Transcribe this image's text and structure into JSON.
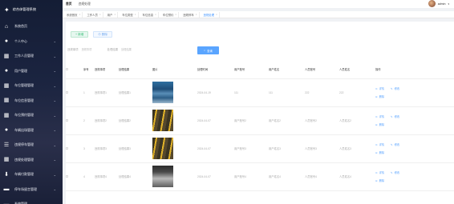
{
  "sidebar": {
    "logo_text": "综合体管理系统",
    "items": [
      {
        "label": "系统首页",
        "icon": "home-icon",
        "glyph": "⌂",
        "has_chevron": false
      },
      {
        "label": "个人中心",
        "icon": "user-icon",
        "glyph": "●",
        "has_chevron": true
      },
      {
        "label": "工作人员管理",
        "icon": "grid-icon",
        "glyph": "▦",
        "has_chevron": true
      },
      {
        "label": "用户管理",
        "icon": "user-group-icon",
        "glyph": "●",
        "has_chevron": true
      },
      {
        "label": "车位管理管理",
        "icon": "grid-icon",
        "glyph": "▦",
        "has_chevron": true
      },
      {
        "label": "车位信息管理",
        "icon": "grid-icon",
        "glyph": "▦",
        "has_chevron": true
      },
      {
        "label": "车位预约管理",
        "icon": "grid-icon",
        "glyph": "▦",
        "has_chevron": true
      },
      {
        "label": "车辆出场管理",
        "icon": "user-icon",
        "glyph": "●",
        "has_chevron": true
      },
      {
        "label": "违规停车管理",
        "icon": "sliders-icon",
        "glyph": "☰",
        "has_chevron": true
      },
      {
        "label": "违规处理管理",
        "icon": "grid-icon",
        "glyph": "▦",
        "has_chevron": true
      },
      {
        "label": "车辆付款管理",
        "icon": "download-icon",
        "glyph": "⬇",
        "has_chevron": true
      },
      {
        "label": "停车场留言管理",
        "icon": "chat-icon",
        "glyph": "▬",
        "has_chevron": true
      },
      {
        "label": "系统管理",
        "icon": "chat-icon",
        "glyph": "▬",
        "has_chevron": true
      }
    ]
  },
  "topbar": {
    "user_name": "admin",
    "breadcrumbs": [
      "首页",
      "违规处理"
    ],
    "tabs": [
      {
        "label": "系统首页",
        "current": false
      },
      {
        "label": "工作人员",
        "current": false
      },
      {
        "label": "用户",
        "current": false
      },
      {
        "label": "车位类型",
        "current": false
      },
      {
        "label": "车位信息",
        "current": false
      },
      {
        "label": "车位预约",
        "current": false
      },
      {
        "label": "违规停车",
        "current": false
      },
      {
        "label": "违规处理",
        "current": true
      }
    ]
  },
  "actions": {
    "add_label": "+ 新增",
    "delete_label": "⊖ 删除"
  },
  "filters": [
    {
      "label": "违规事项",
      "placeholder": "违规事项"
    },
    {
      "label": "处理结果",
      "placeholder": "处理结果"
    }
  ],
  "search_label": "查询",
  "table": {
    "headers": [
      "序号",
      "违规事项",
      "处理结果",
      "图片",
      "处理时间",
      "用户账号",
      "用户姓名",
      "人员账号",
      "人员姓名",
      "操作"
    ],
    "rows": [
      {
        "index": "1",
        "matter": "违规事项1",
        "result": "处理结果1",
        "image": "parking-blue",
        "time": "2024-04-19",
        "user_account": "111",
        "user_name": "111",
        "staff_account": "222",
        "staff_name": "222"
      },
      {
        "index": "2",
        "matter": "违规事项2",
        "result": "处理结果2",
        "image": "parking-yellow",
        "time": "2024-04-07",
        "user_account": "用户账号2",
        "user_name": "用户姓名2",
        "staff_account": "人员账号2",
        "staff_name": "人员姓名2"
      },
      {
        "index": "3",
        "matter": "违规事项3",
        "result": "处理结果3",
        "image": "parking-yellow",
        "time": "2024-04-07",
        "user_account": "用户账号3",
        "user_name": "用户姓名3",
        "staff_account": "人员账号3",
        "staff_name": "人员姓名3"
      },
      {
        "index": "4",
        "matter": "违规事项4",
        "result": "处理结果4",
        "image": "parking-dark",
        "time": "2024-04-07",
        "user_account": "用户账号4",
        "user_name": "用户姓名4",
        "staff_account": "人员账号4",
        "staff_name": "人员姓名4"
      }
    ],
    "op_detail": "详情",
    "op_edit": "修改",
    "op_delete": "删除"
  }
}
